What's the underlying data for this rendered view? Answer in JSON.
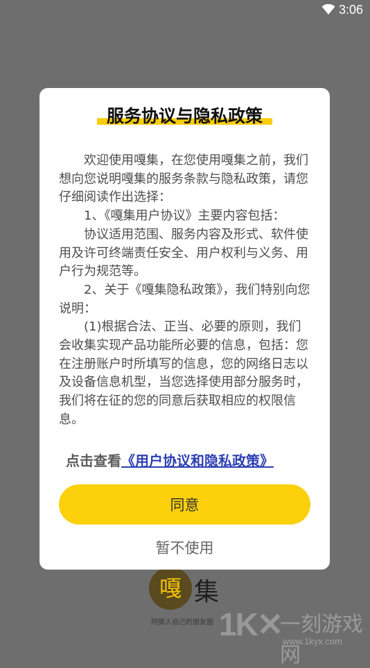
{
  "status_bar": {
    "time": "3:06"
  },
  "splash": {
    "logo_char": "嘎",
    "logo_text": "集",
    "slogan": "阿旗人自己的朋友圈"
  },
  "watermark": {
    "mark": "1K✕",
    "name": "一刻游戏网",
    "url": "www.1kyx.com"
  },
  "dialog": {
    "title": "服务协议与隐私政策",
    "paragraphs": [
      "欢迎使用嘎集，在您使用嘎集之前，我们想向您说明嘎集的服务条款与隐私政策，请您仔细阅读作出选择：",
      "1、《嘎集用户协议》主要内容包括：",
      "协议适用范围、服务内容及形式、软件使用及许可终端责任安全、用户权利与义务、用户行为规范等。",
      "2、关于《嘎集隐私政策》，我们特别向您说明：",
      "(1)根据合法、正当、必要的原则，我们会收集实现产品功能所必要的信息，包括：您在注册账户时所填写的信息，您的网络日志以及设备信息机型，当您选择使用部分服务时，我们将在征的您的同意后获取相应的权限信息。"
    ],
    "link_prefix": "点击查看",
    "link_text": "《用户协议和隐私政策》",
    "agree_label": "同意",
    "decline_label": "暂不使用"
  }
}
